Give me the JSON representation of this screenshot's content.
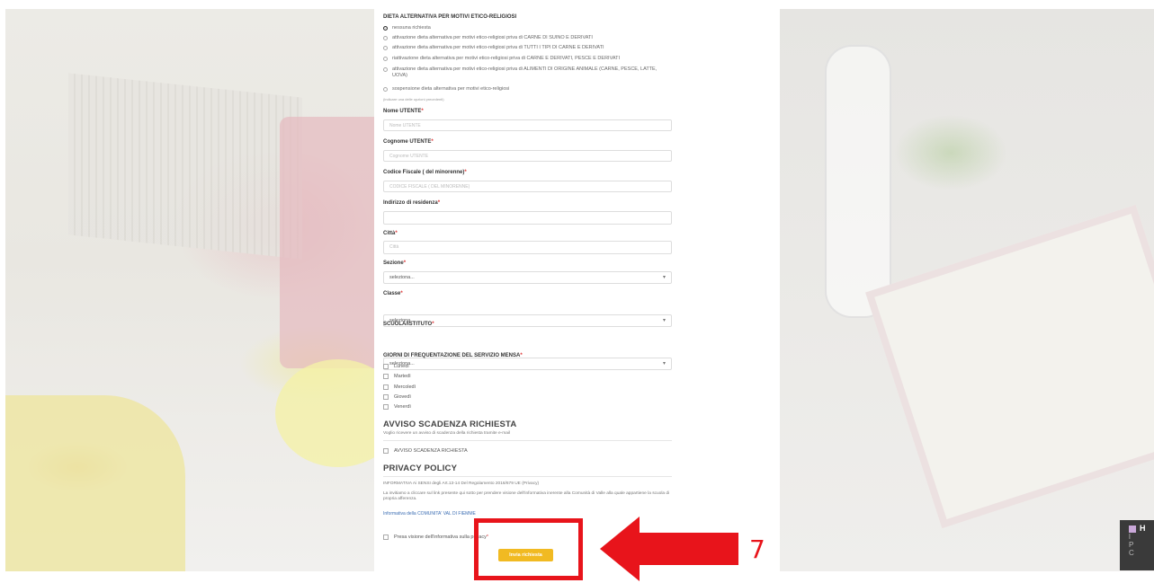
{
  "diet": {
    "title": "DIETA ALTERNATIVA PER MOTIVI ETICO-RELIGIOSI",
    "options": [
      {
        "label": "nessuna richiesta",
        "selected": true
      },
      {
        "label": "attivazione dieta alternativa per motivi etico-religiosi priva di CARNE DI SUINO E DERIVATI",
        "selected": false
      },
      {
        "label": "attivazione dieta alternativa per motivi etico-religiosi priva di TUTTI I TIPI DI CARNE E DERIVATI",
        "selected": false
      },
      {
        "label": "riattivazione dieta alternativa per motivi etico-religiosi priva di CARNE E DERIVATI, PESCE E DERIVATI",
        "selected": false
      },
      {
        "label": "attivazione dieta alternativa per motivi etico-religiosi priva di ALIMENTI DI ORIGINE ANIMALE (CARNE, PESCE, LATTE, UOVA)",
        "selected": false
      },
      {
        "label": "sospensione dieta alternativa per motivi etico-religiosi",
        "selected": false
      }
    ],
    "hint": "(indicare una delle opzioni precedenti)"
  },
  "fields": {
    "nome": {
      "label": "Nome UTENTE",
      "placeholder": "Nome UTENTE"
    },
    "cognome": {
      "label": "Cognome UTENTE",
      "placeholder": "Cognome UTENTE"
    },
    "codice": {
      "label": "Codice Fiscale ( del minorenne)",
      "placeholder": "CODICE FISCALE ( DEL MINORENNE)"
    },
    "indirizzo": {
      "label": "Indirizzo di residenza",
      "placeholder": ""
    },
    "citta": {
      "label": "Città",
      "placeholder": "Città"
    },
    "sezione": {
      "label": "Sezione",
      "value": "seleziona..."
    },
    "classe": {
      "label": "Classe",
      "value": "seleziona..."
    },
    "scuola": {
      "label": "SCUOLA/ISTITUTO",
      "value": "seleziona..."
    }
  },
  "required_mark": "*",
  "days": {
    "title": "GIORNI DI FREQUENTAZIONE DEL SERVIZIO MENSA",
    "items": [
      "Lunedì",
      "Martedì",
      "Mercoledì",
      "Giovedì",
      "Venerdì"
    ]
  },
  "avviso": {
    "heading": "AVVISO SCADENZA RICHIESTA",
    "sub": "Voglio ricevere un avviso di scadenza della richiesta tramite e-mail",
    "checkbox": "AVVISO SCADENZA RICHIESTA"
  },
  "privacy": {
    "heading": "PRIVACY POLICY",
    "info": "INFORMATIVA Ai SENSI degli Art.13-14 Del Regolamento 2016/679 UE (Privacy)",
    "text": "La invitiamo a cliccare sul link presente qui sotto per prendere visione dell'informativa inerente alla Comunità di Valle alla quale appartiene la scuola di propria afferenza.",
    "link": "Informativa della COMUNITA' VAL DI FIEMME",
    "checkbox": "Presa visione dell'informativa sulla privacy"
  },
  "submit": "Invia richiesta",
  "annotation": {
    "step": "7",
    "color": "#e8141b"
  },
  "colors": {
    "accent": "#f1ba22",
    "link": "#3b6db3"
  },
  "toast": {
    "title": "H",
    "lines": [
      "l",
      "P",
      "C"
    ]
  }
}
